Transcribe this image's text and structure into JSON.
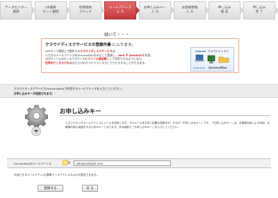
{
  "steps": [
    {
      "label": "データセンター\n選択",
      "active": false
    },
    {
      "label": "OS選択\nセット選択",
      "active": false
    },
    {
      "label": "利用規約\nスペック",
      "active": false
    },
    {
      "label": "メールアドレス\n入 力",
      "active": true
    },
    {
      "label": "お申し込みキー\n入 力",
      "active": false
    },
    {
      "label": "お客様情報\n入 力",
      "active": false
    },
    {
      "label": "申し込み\n確 認",
      "active": false
    },
    {
      "label": "申し込み\n完 了",
      "active": false
    }
  ],
  "subtitle": "続いて・・・",
  "notice": {
    "heading_main": "クラウドディスクサービスの登録作業",
    "heading_suffix": "に入ります。",
    "body_pre": "VPSサーバ環境上で動作する",
    "body_hl1": "クラウドディスクサービス",
    "body_mid": "は、\n入力するメールアドレスをServersManのIDとして登録し、",
    "body_hl2": "Web や WebDAV",
    "body_post": "を利用、\nVPSサーバ上のディスクスペースを",
    "body_hl3": "ファイル保存庫",
    "body_post2": "として利用できるようになり、",
    "body_hl4": "世界中どこからでも",
    "body_post3": "あなただけのクラウドディスクにアクセスすることができます。",
    "promo": {
      "upload": "Upload",
      "title": "クラウドディスク",
      "download": "Download",
      "brand": "ServersMan"
    }
  },
  "info": {
    "line1": "クラウドディスクサービス(ServersMan)で利用するメールアドレスを入力してください。",
    "line2": "お申し込みキーが送信されます。"
  },
  "section": {
    "title": "お申し込みキー",
    "desc": "入力いただいたメールアドレスにメールを送信します。そのメール本文中に記載の英数字が、それが「お申し込みキー」です。「お申し込みキー」は、お客様自身による利用、お客様の個人認証をするためのキーとなります。次の画面で「お申し込みキー」を入力してください。"
  },
  "form": {
    "label": "ServersManのメールアドレス",
    "email_value": "abc@example.com",
    "footnote": "お送りするメールアドレス(携帯メールアドレスもOK)を設定できます。"
  },
  "buttons": {
    "register": "登録する",
    "back": "戻 る"
  },
  "colors": {
    "active_step": "#c13a3a",
    "highlight": "#d4211f",
    "notice_border": "#e7a57f"
  }
}
